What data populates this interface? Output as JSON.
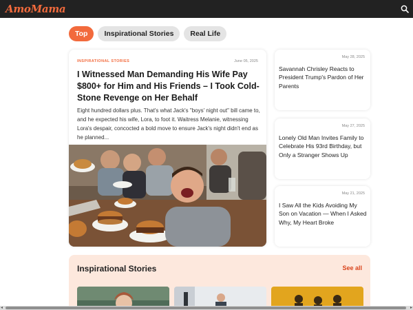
{
  "header": {
    "logo_text": "AmoMama",
    "search_icon": "search-icon",
    "logo_color": "#f26a3c",
    "background": "#222222"
  },
  "tabs": [
    {
      "label": "Top",
      "active": true
    },
    {
      "label": "Inspirational Stories",
      "active": false
    },
    {
      "label": "Real Life",
      "active": false
    }
  ],
  "featured": {
    "category": "INSPIRATIONAL STORIES",
    "date": "June 05, 2025",
    "title": "I Witnessed Man Demanding His Wife Pay $800+ for Him and His Friends – I Took Cold-Stone Revenge on Her Behalf",
    "excerpt": "Eight hundred dollars plus. That's what Jack's \"boys' night out\" bill came to, and he expected his wife, Lora, to foot it. Waitress Melanie, witnessing Lora's despair, concocted a bold move to ensure Jack's night didn't end as he planned..."
  },
  "side_articles": [
    {
      "date": "May 28, 2025",
      "title": "Savannah Chrisley Reacts to President Trump's Pardon of Her Parents"
    },
    {
      "date": "May 27, 2025",
      "title": "Lonely Old Man Invites Family to Celebrate His 93rd Birthday, but Only a Stranger Shows Up"
    },
    {
      "date": "May 21, 2025",
      "title": "I Saw All the Kids Avoiding My Son on Vacation — When I Asked Why, My Heart Broke"
    }
  ],
  "inspirational_section": {
    "title": "Inspirational Stories",
    "see_all": "See all"
  },
  "colors": {
    "accent": "#f26a3c",
    "section_bg": "#fde8dd",
    "see_all": "#d9441c"
  }
}
